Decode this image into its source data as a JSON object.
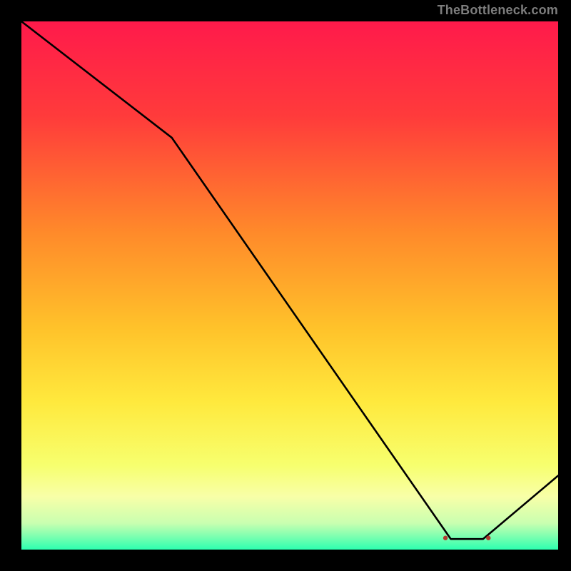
{
  "attribution": "TheBottleneck.com",
  "chart_data": {
    "type": "line",
    "title": "",
    "xlabel": "",
    "ylabel": "",
    "xlim": [
      0,
      100
    ],
    "ylim": [
      0,
      100
    ],
    "grid": false,
    "series": [
      {
        "name": "bottleneck-curve",
        "x": [
          0,
          28,
          80,
          86,
          100
        ],
        "y": [
          100,
          78,
          2,
          2,
          14
        ]
      }
    ],
    "annotations": [
      {
        "name": "optimal-marker-left",
        "x": 79,
        "y": 2.2
      },
      {
        "name": "optimal-marker-right",
        "x": 87,
        "y": 2.2
      }
    ],
    "annotation_label": "",
    "gradient_stops": [
      {
        "offset": 0.0,
        "color": "#ff1a4b"
      },
      {
        "offset": 0.18,
        "color": "#ff3b3b"
      },
      {
        "offset": 0.4,
        "color": "#ff8a2a"
      },
      {
        "offset": 0.58,
        "color": "#ffc22a"
      },
      {
        "offset": 0.72,
        "color": "#ffe93d"
      },
      {
        "offset": 0.84,
        "color": "#f7ff6e"
      },
      {
        "offset": 0.9,
        "color": "#f8ffa8"
      },
      {
        "offset": 0.95,
        "color": "#c9ffb0"
      },
      {
        "offset": 0.975,
        "color": "#7dffb0"
      },
      {
        "offset": 1.0,
        "color": "#2dffb0"
      }
    ],
    "annotation_color": "#b23a2f"
  }
}
